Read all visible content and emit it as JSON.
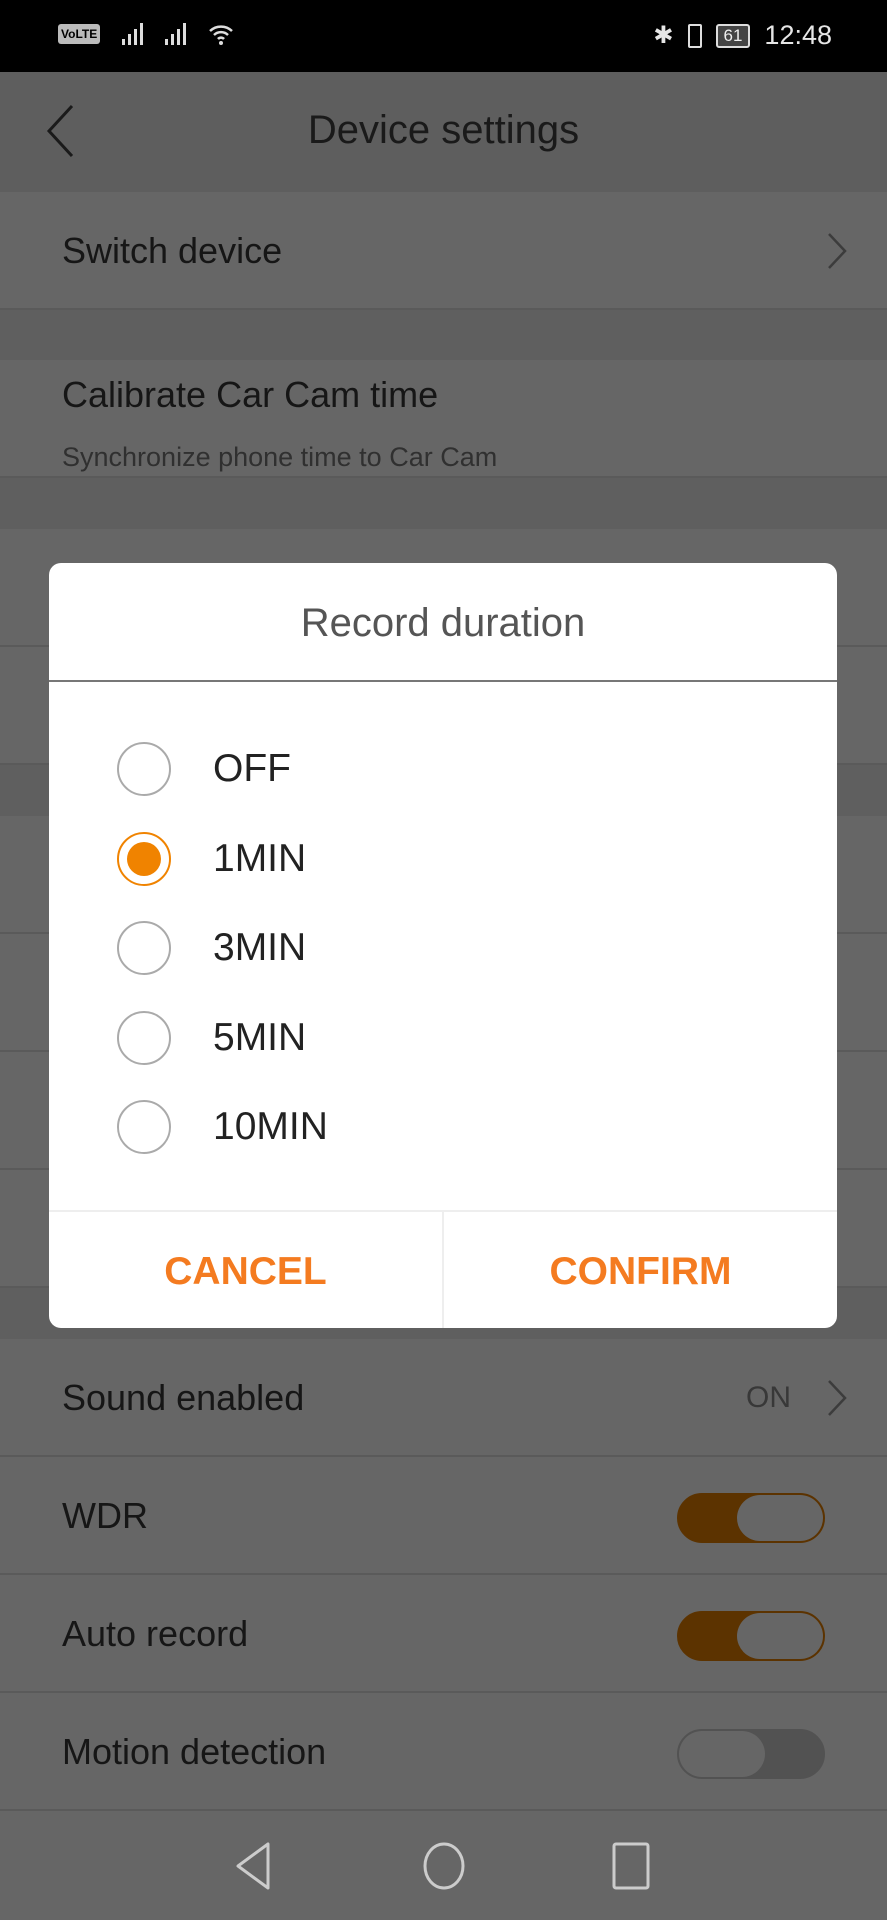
{
  "status_bar": {
    "network": "VoLTE",
    "sim": "1",
    "battery": "61",
    "time": "12:48"
  },
  "header": {
    "title": "Device settings"
  },
  "rows": [
    {
      "label": "Switch device"
    },
    {
      "label": "Calibrate Car Cam time",
      "sub": "Synchronize phone time to Car Cam"
    },
    {
      "label": "Sound enabled",
      "value": "ON"
    },
    {
      "label": "WDR",
      "toggle": true
    },
    {
      "label": "Auto record",
      "toggle": true
    },
    {
      "label": "Motion detection",
      "toggle": false
    }
  ],
  "dialog": {
    "title": "Record duration",
    "options": [
      "OFF",
      "1MIN",
      "3MIN",
      "5MIN",
      "10MIN"
    ],
    "selected": "1MIN",
    "cancel": "CANCEL",
    "confirm": "CONFIRM"
  },
  "colors": {
    "accent": "#f08300",
    "button_text": "#f47b20",
    "toggle_on": "#e67e00"
  }
}
